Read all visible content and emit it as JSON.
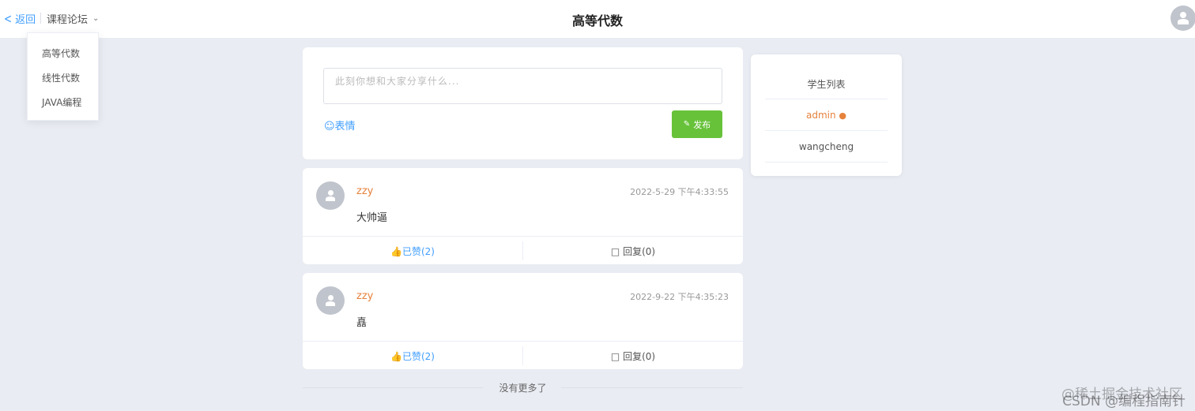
{
  "header": {
    "back_label": "返回",
    "forum_label": "课程论坛",
    "title": "高等代数"
  },
  "dropdown": {
    "items": [
      "高等代数",
      "线性代数",
      "JAVA编程"
    ]
  },
  "composer": {
    "placeholder": "此刻你想和大家分享什么...",
    "emoji_label": "☺表情",
    "publish_label": "发布"
  },
  "posts": [
    {
      "author": "zzy",
      "time": "2022-5-29 下午4:33:55",
      "content": "大帅逼",
      "like_label": "已赞(2)",
      "reply_label": "回复(0)"
    },
    {
      "author": "zzy",
      "time": "2022-9-22 下午4:35:23",
      "content": "嚞",
      "like_label": "已赞(2)",
      "reply_label": "回复(0)"
    }
  ],
  "no_more": "没有更多了",
  "students": {
    "title": "学生列表",
    "items": [
      "admin",
      "wangcheng"
    ]
  },
  "watermark": {
    "line1": "@稀土掘金技术社区",
    "line2": "CSDN @编程指南针"
  },
  "colors": {
    "accent": "#409eff",
    "publish": "#67c23a",
    "author": "#e6823c",
    "background": "#e9ecf2"
  }
}
